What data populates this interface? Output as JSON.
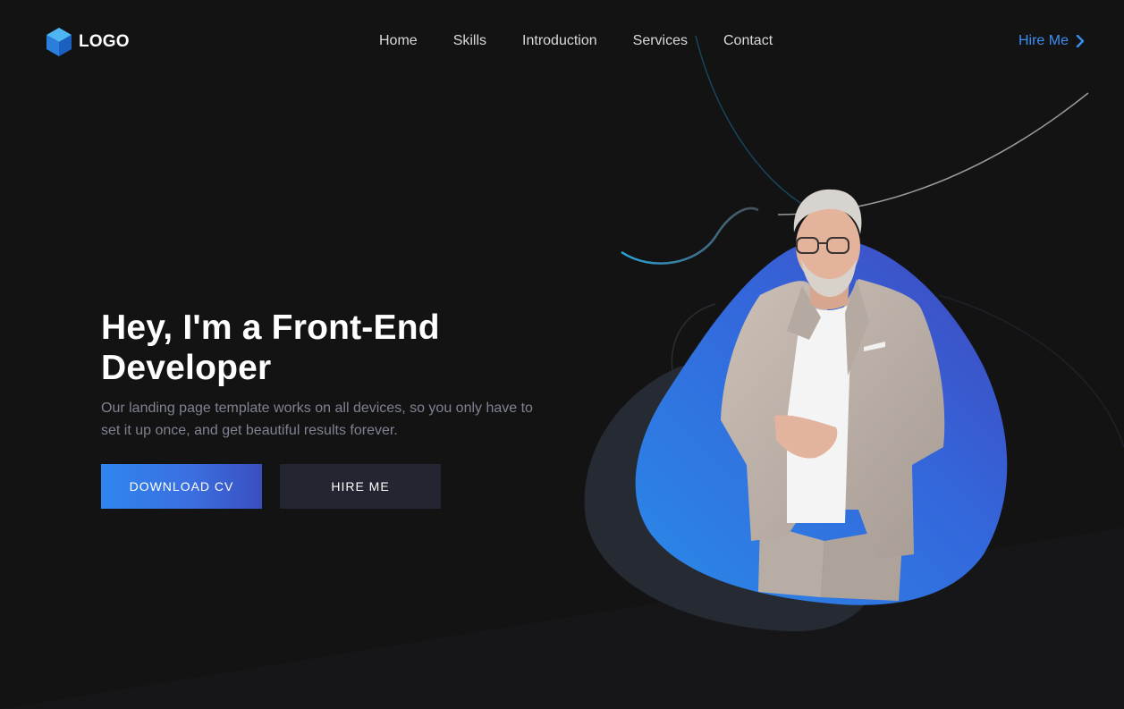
{
  "header": {
    "logo_text": "LOGO",
    "nav": [
      {
        "label": "Home"
      },
      {
        "label": "Skills"
      },
      {
        "label": "Introduction"
      },
      {
        "label": "Services"
      },
      {
        "label": "Contact"
      }
    ],
    "hire_link": "Hire Me"
  },
  "hero": {
    "title_line1": "Hey, I'm a Front-End",
    "title_line2": "Developer",
    "subtitle": "Our landing page template works on all devices, so you only have to set it up once, and get beautiful results forever.",
    "primary_button": "DOWNLOAD CV",
    "secondary_button": "HIRE ME"
  },
  "icons": {
    "logo": "cube-icon",
    "hire_link": "chevron-right-icon"
  },
  "colors": {
    "background": "#131314",
    "accent": "#3b8ff0",
    "blob_start": "#2a88e8",
    "blob_end": "#4050c4",
    "dark_blob": "#262a33"
  }
}
